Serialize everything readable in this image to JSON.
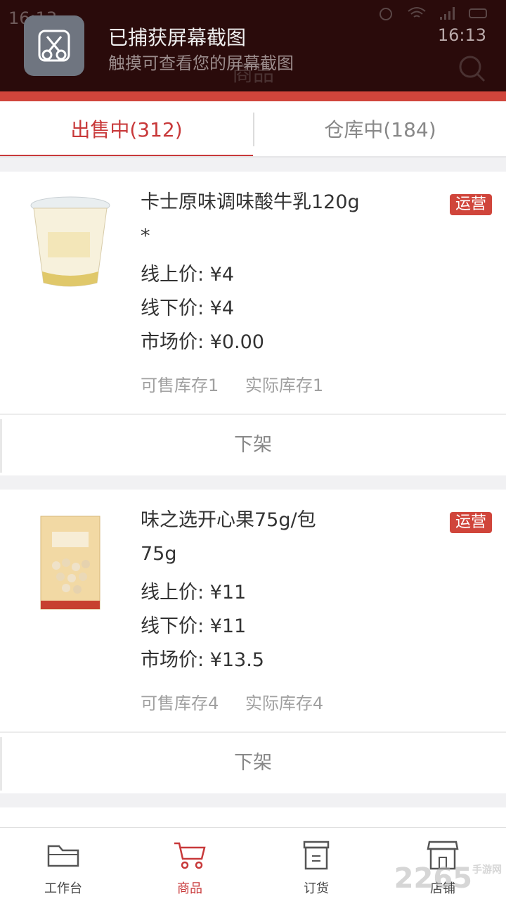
{
  "status_bar": {
    "time": "16:13"
  },
  "notification": {
    "title": "已捕获屏幕截图",
    "subtitle": "触摸可查看您的屏幕截图",
    "time": "16:13"
  },
  "header": {
    "title": "商品"
  },
  "tabs": [
    {
      "label": "出售中(312)",
      "active": true
    },
    {
      "label": "仓库中(184)",
      "active": false
    }
  ],
  "products": [
    {
      "name": "卡士原味调味酸牛乳120g",
      "spec": "*",
      "badge": "运营",
      "online_price": "线上价: ¥4",
      "offline_price": "线下价: ¥4",
      "market_price": "市场价: ¥0.00",
      "available_stock": "可售库存1",
      "actual_stock": "实际库存1",
      "action": "下架"
    },
    {
      "name": "味之选开心果75g/包",
      "spec": "75g",
      "badge": "运营",
      "online_price": "线上价: ¥11",
      "offline_price": "线下价: ¥11",
      "market_price": "市场价: ¥13.5",
      "available_stock": "可售库存4",
      "actual_stock": "实际库存4",
      "action": "下架"
    }
  ],
  "tabbar": [
    {
      "label": "工作台",
      "icon": "folder-icon",
      "selected": false
    },
    {
      "label": "商品",
      "icon": "cart-icon",
      "selected": true
    },
    {
      "label": "订货",
      "icon": "order-box-icon",
      "selected": false
    },
    {
      "label": "店铺",
      "icon": "store-icon",
      "selected": false
    }
  ],
  "watermark": {
    "text": "2265",
    "sub": "手游网"
  },
  "colors": {
    "accent": "#c8393a",
    "header": "#2a0b0b",
    "badge": "#d0453b"
  }
}
